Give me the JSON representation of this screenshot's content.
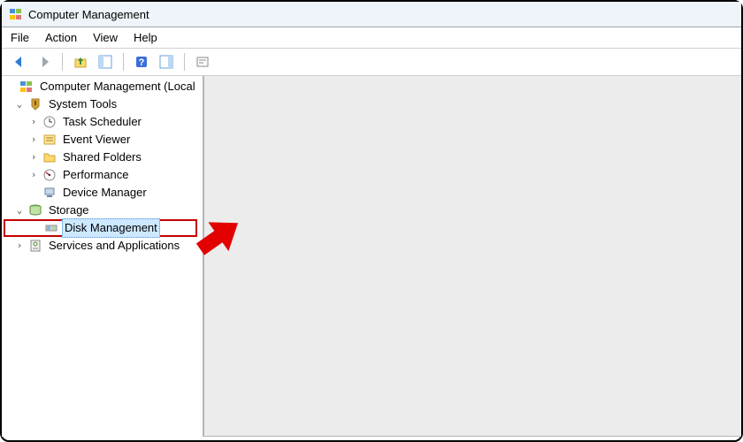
{
  "window": {
    "title": "Computer Management"
  },
  "menubar": {
    "file": "File",
    "action": "Action",
    "view": "View",
    "help": "Help"
  },
  "tree": {
    "root": "Computer Management (Local",
    "system_tools": {
      "label": "System Tools",
      "children": {
        "task_scheduler": "Task Scheduler",
        "event_viewer": "Event Viewer",
        "shared_folders": "Shared Folders",
        "performance": "Performance",
        "device_manager": "Device Manager"
      }
    },
    "storage": {
      "label": "Storage",
      "children": {
        "disk_management": "Disk Management"
      }
    },
    "services_apps": {
      "label": "Services and Applications"
    }
  }
}
